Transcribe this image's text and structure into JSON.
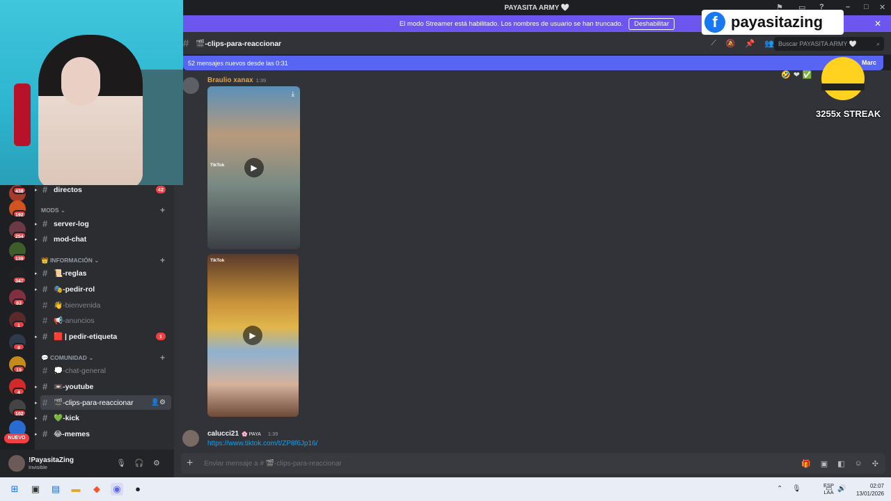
{
  "window": {
    "title": "PAYASITA ARMY 🤍"
  },
  "banner": {
    "text": "El modo Streamer está habilitado. Los nombres de usuario se han truncado.",
    "button": "Deshabilitar"
  },
  "overlay": {
    "facebook_name": "payasitazing",
    "streak": "3255x STREAK"
  },
  "channel_header": {
    "name": "🎬-clips-para-reaccionar",
    "search_placeholder": "Buscar PAYASITA ARMY 🤍"
  },
  "new_messages": {
    "text": "52 mensajes nuevos desde las 0:31",
    "mark": "Marc"
  },
  "messages": [
    {
      "author": "Braulio xanax",
      "time": "1:39",
      "author_color": "#e6a23c",
      "media": [
        "video",
        "video"
      ],
      "tiktok_label": "TikTok"
    },
    {
      "author": "calucci21",
      "tag": "🌸 PAYA",
      "time": "1:39",
      "author_color": "#f2f3f5",
      "link": "https://www.tiktok.com/t/ZP8f6Jp16/"
    }
  ],
  "server_badges": [
    "438",
    "192",
    "254",
    "139",
    "347",
    "83",
    "1",
    "9",
    "19",
    "4",
    "102"
  ],
  "new_label": "NUEVO",
  "channel_list": {
    "top": {
      "name": "directos",
      "count": "42"
    },
    "categories": [
      {
        "name": "MODS ⌄",
        "channels": [
          "server-log",
          "mod-chat"
        ]
      },
      {
        "name": "👑 INFORMACIÓN ⌄",
        "channels": [
          "📜-reglas",
          "🎭-pedir-rol",
          "👋-bienvenida",
          "📢-anuncios",
          "🟥 | pedir-etiqueta"
        ],
        "pedir_count": "1"
      },
      {
        "name": "💬 COMUNIDAD ⌄",
        "channels": [
          "💭-chat-general",
          "📼-youtube",
          "🎬-clips-para-reaccionar",
          "💚-kick",
          "😂-memes"
        ]
      }
    ]
  },
  "user": {
    "name": "!PayasitaZing",
    "status": "Invisible"
  },
  "composer": {
    "placeholder": "Enviar mensaje a # 🎬-clips-para-reaccionar"
  },
  "taskbar": {
    "lang_top": "ESP",
    "lang_bottom": "LAA",
    "time": "02:07",
    "date": "13/01/2026"
  }
}
